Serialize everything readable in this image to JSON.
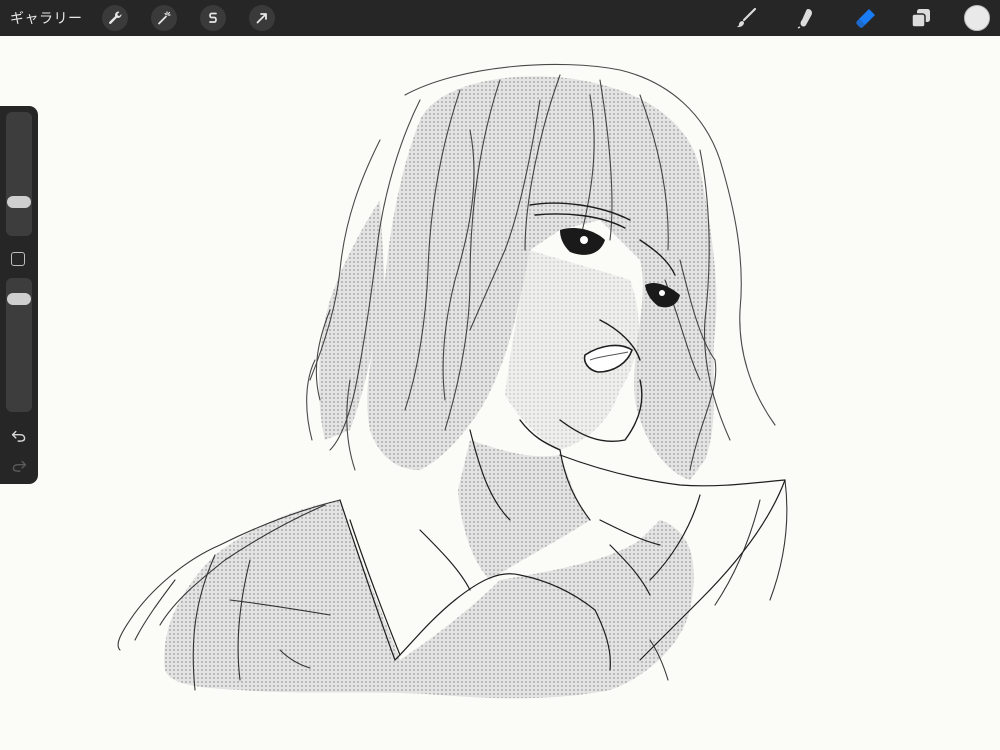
{
  "app": {
    "gallery_label": "ギャラリー"
  },
  "toolbar": {
    "left_tools": [
      {
        "name": "actions",
        "icon": "wrench-icon"
      },
      {
        "name": "adjustments",
        "icon": "magic-wand-icon"
      },
      {
        "name": "selection",
        "icon": "selection-s-icon"
      },
      {
        "name": "transform",
        "icon": "arrow-cursor-icon"
      }
    ],
    "right_tools": [
      {
        "name": "brush",
        "icon": "brush-icon",
        "active": false
      },
      {
        "name": "smudge",
        "icon": "smudge-icon",
        "active": false
      },
      {
        "name": "eraser",
        "icon": "eraser-icon",
        "active": true
      },
      {
        "name": "layers",
        "icon": "layers-icon",
        "active": false
      }
    ],
    "active_color": "#e9e9e9",
    "accent_color": "#1a7cf5"
  },
  "sidebar": {
    "brush_size_level": 0.25,
    "opacity_level": 0.88
  }
}
